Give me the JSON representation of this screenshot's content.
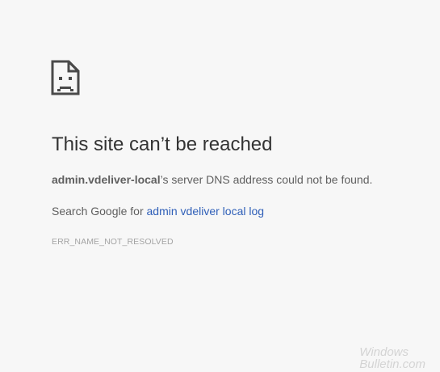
{
  "error_page": {
    "icon": "sad-page-icon",
    "title": "This site can’t be reached",
    "summary": {
      "host": "admin.vdeliver-local",
      "message": "’s server DNS address could not be found."
    },
    "search": {
      "prefix": "Search Google for ",
      "link_text": "admin vdeliver local log"
    },
    "error_code": "ERR_NAME_NOT_RESOLVED"
  },
  "watermark": {
    "line1": "Windows",
    "line2": "Bulletin.com"
  },
  "colors": {
    "background": "#f7f7f7",
    "title": "#333333",
    "body_text": "#5f5f5f",
    "link": "#2f5fb8",
    "error_code": "#a4a4a4"
  }
}
